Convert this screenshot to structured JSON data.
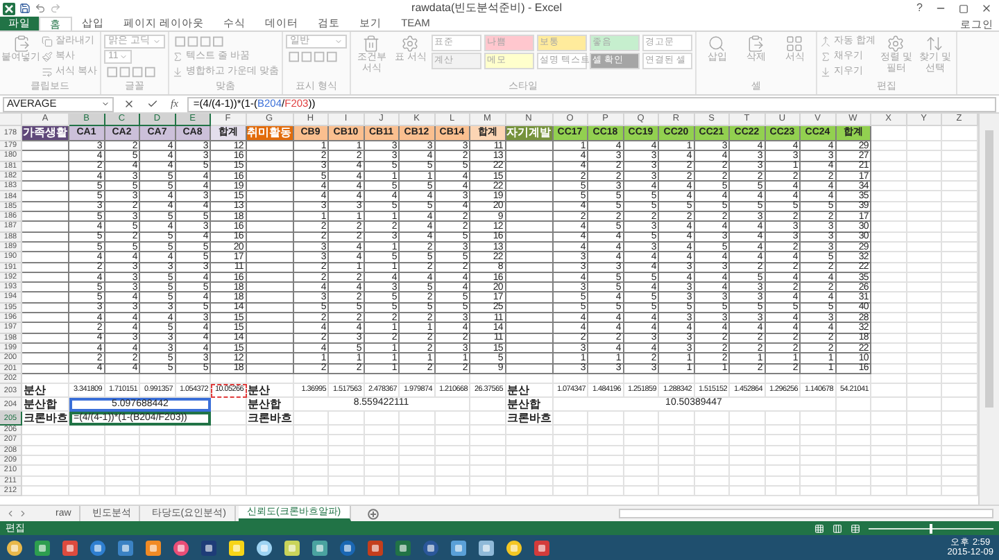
{
  "window": {
    "title": "rawdata(빈도분석준비) - Excel",
    "help": "?",
    "account": "로그인"
  },
  "ribbon_tabs": [
    {
      "label": "파일",
      "kind": "file",
      "selected": false
    },
    {
      "label": "홈",
      "kind": "tab",
      "selected": true
    },
    {
      "label": "삽입",
      "kind": "tab",
      "selected": false
    },
    {
      "label": "페이지 레이아웃",
      "kind": "tab",
      "selected": false
    },
    {
      "label": "수식",
      "kind": "tab",
      "selected": false
    },
    {
      "label": "데이터",
      "kind": "tab",
      "selected": false
    },
    {
      "label": "검토",
      "kind": "tab",
      "selected": false
    },
    {
      "label": "보기",
      "kind": "tab",
      "selected": false
    },
    {
      "label": "TEAM",
      "kind": "tab",
      "selected": false
    }
  ],
  "ribbon": {
    "disabled": true,
    "groups": [
      {
        "label": "클립보드",
        "items": [
          {
            "kind": "large",
            "text": "붙여넣기"
          },
          {
            "kind": "small",
            "text": "잘라내기"
          },
          {
            "kind": "small",
            "text": "복사"
          },
          {
            "kind": "small",
            "text": "서식 복사"
          }
        ]
      },
      {
        "label": "글꼴",
        "items": [
          {
            "kind": "field",
            "text": "맑은 고딕",
            "wide": true
          },
          {
            "kind": "field",
            "text": "11",
            "wide": false
          },
          {
            "kind": "tools"
          }
        ]
      },
      {
        "label": "맞춤",
        "items": [
          {
            "kind": "tools"
          },
          {
            "kind": "small",
            "text": "텍스트 줄 바꿈"
          },
          {
            "kind": "small",
            "text": "병합하고 가운데 맞춤"
          }
        ]
      },
      {
        "label": "표시 형식",
        "items": [
          {
            "kind": "field",
            "text": "일반",
            "wide": true
          },
          {
            "kind": "tools"
          }
        ]
      },
      {
        "label": "스타일",
        "items": [
          {
            "kind": "large",
            "text": "조건부 서식"
          },
          {
            "kind": "large",
            "text": "표 서식"
          },
          {
            "kind": "style",
            "text": "표준",
            "color": "#ffffff"
          },
          {
            "kind": "style",
            "text": "계산",
            "color": "#f2f2f2"
          },
          {
            "kind": "style",
            "text": "나쁨",
            "color": "#ffc7ce"
          },
          {
            "kind": "style",
            "text": "메모",
            "color": "#ffffcc"
          },
          {
            "kind": "style",
            "text": "보통",
            "color": "#ffeb9c"
          },
          {
            "kind": "style",
            "text": "설명 텍스트",
            "color": "#ffffff"
          },
          {
            "kind": "style",
            "text": "좋음",
            "color": "#c6efce"
          },
          {
            "kind": "style",
            "text": "셀 확인",
            "color": "#a5a5a5"
          },
          {
            "kind": "style",
            "text": "경고문",
            "color": "#ffffff"
          },
          {
            "kind": "style",
            "text": "연결된 셀",
            "color": "#ffffff"
          }
        ]
      },
      {
        "label": "셀",
        "items": [
          {
            "kind": "large",
            "text": "삽입"
          },
          {
            "kind": "large",
            "text": "삭제"
          },
          {
            "kind": "large",
            "text": "서식"
          }
        ]
      },
      {
        "label": "편집",
        "items": [
          {
            "kind": "small",
            "text": "자동 합계"
          },
          {
            "kind": "small",
            "text": "채우기"
          },
          {
            "kind": "small",
            "text": "지우기"
          },
          {
            "kind": "large",
            "text": "정렬 및 필터"
          },
          {
            "kind": "large",
            "text": "찾기 및 선택"
          }
        ]
      }
    ]
  },
  "formula_bar": {
    "name_box": "AVERAGE",
    "function_label": "fx",
    "formula": [
      {
        "text": "=(4/(4-1))*(1-("
      },
      {
        "text": "B204",
        "color": "#3a6fd8"
      },
      {
        "text": "/"
      },
      {
        "text": "F203",
        "color": "#e03c3c"
      },
      {
        "text": "))"
      }
    ]
  },
  "sheet": {
    "columns": [
      {
        "label": "A",
        "selected": false
      },
      {
        "label": "B",
        "selected": true
      },
      {
        "label": "C",
        "selected": true
      },
      {
        "label": "D",
        "selected": true
      },
      {
        "label": "E",
        "selected": true
      },
      {
        "label": "F",
        "selected": false
      },
      {
        "label": "G",
        "selected": false
      },
      {
        "label": "H",
        "selected": false
      },
      {
        "label": "I",
        "selected": false
      },
      {
        "label": "J",
        "selected": false
      },
      {
        "label": "K",
        "selected": false
      },
      {
        "label": "L",
        "selected": false
      },
      {
        "label": "M",
        "selected": false
      },
      {
        "label": "N",
        "selected": false
      },
      {
        "label": "O",
        "selected": false
      },
      {
        "label": "P",
        "selected": false
      },
      {
        "label": "Q",
        "selected": false
      },
      {
        "label": "R",
        "selected": false
      },
      {
        "label": "S",
        "selected": false
      },
      {
        "label": "T",
        "selected": false
      },
      {
        "label": "U",
        "selected": false
      },
      {
        "label": "V",
        "selected": false
      },
      {
        "label": "W",
        "selected": false
      },
      {
        "label": "X",
        "selected": false
      },
      {
        "label": "Y",
        "selected": false
      },
      {
        "label": "Z",
        "selected": false
      }
    ],
    "rows": [
      {
        "number": "178",
        "selected": false,
        "blocks": [
          {
            "label": {
              "text": "가족생활",
              "color": "#60497a"
            },
            "headings": [
              {
                "text": "CA1",
                "color": "#ccc0da"
              },
              {
                "text": "CA2",
                "color": "#ccc0da"
              },
              {
                "text": "CA7",
                "color": "#ccc0da"
              },
              {
                "text": "CA8",
                "color": "#ccc0da"
              },
              {
                "text": "합계",
                "color": "#e4dfec"
              }
            ]
          },
          {
            "label": {
              "text": "취미활동",
              "color": "#e26b0a"
            },
            "headings": [
              {
                "text": "CB9",
                "color": "#fabf8f"
              },
              {
                "text": "CB10",
                "color": "#fabf8f"
              },
              {
                "text": "CB11",
                "color": "#fabf8f"
              },
              {
                "text": "CB12",
                "color": "#fabf8f"
              },
              {
                "text": "CB14",
                "color": "#fabf8f"
              },
              {
                "text": "합계",
                "color": "#fcd5b4"
              }
            ]
          },
          {
            "label": {
              "text": "자기계발",
              "color": "#76933c"
            },
            "headings": [
              {
                "text": "CC17",
                "color": "#92d050"
              },
              {
                "text": "CC18",
                "color": "#92d050"
              },
              {
                "text": "CC19",
                "color": "#92d050"
              },
              {
                "text": "CC20",
                "color": "#92d050"
              },
              {
                "text": "CC21",
                "color": "#92d050"
              },
              {
                "text": "CC22",
                "color": "#92d050"
              },
              {
                "text": "CC23",
                "color": "#92d050"
              },
              {
                "text": "CC24",
                "color": "#92d050"
              },
              {
                "text": "합계",
                "color": "#92d050"
              }
            ]
          }
        ]
      },
      {
        "number": "179",
        "selected": false,
        "blocks": [
          {
            "values": [
              "3",
              "2",
              "4",
              "3",
              "12"
            ]
          },
          {
            "values": [
              "1",
              "1",
              "3",
              "3",
              "3",
              "11"
            ]
          },
          {
            "values": [
              "1",
              "4",
              "4",
              "1",
              "3",
              "4",
              "4",
              "4",
              "29"
            ]
          }
        ]
      },
      {
        "number": "180",
        "selected": false,
        "blocks": [
          {
            "values": [
              "4",
              "5",
              "4",
              "3",
              "16"
            ]
          },
          {
            "values": [
              "2",
              "2",
              "3",
              "4",
              "2",
              "13"
            ]
          },
          {
            "values": [
              "4",
              "3",
              "3",
              "4",
              "4",
              "3",
              "3",
              "3",
              "27"
            ]
          }
        ]
      },
      {
        "number": "181",
        "selected": false,
        "blocks": [
          {
            "values": [
              "2",
              "4",
              "4",
              "5",
              "15"
            ]
          },
          {
            "values": [
              "3",
              "4",
              "5",
              "5",
              "5",
              "22"
            ]
          },
          {
            "values": [
              "4",
              "2",
              "3",
              "2",
              "2",
              "3",
              "1",
              "4",
              "21"
            ]
          }
        ]
      },
      {
        "number": "182",
        "selected": false,
        "blocks": [
          {
            "values": [
              "4",
              "3",
              "5",
              "4",
              "16"
            ]
          },
          {
            "values": [
              "5",
              "4",
              "1",
              "1",
              "4",
              "15"
            ]
          },
          {
            "values": [
              "2",
              "2",
              "3",
              "2",
              "2",
              "2",
              "2",
              "2",
              "17"
            ]
          }
        ]
      },
      {
        "number": "183",
        "selected": false,
        "blocks": [
          {
            "values": [
              "5",
              "5",
              "5",
              "4",
              "19"
            ]
          },
          {
            "values": [
              "4",
              "4",
              "5",
              "5",
              "4",
              "22"
            ]
          },
          {
            "values": [
              "5",
              "3",
              "4",
              "4",
              "5",
              "5",
              "4",
              "4",
              "34"
            ]
          }
        ]
      },
      {
        "number": "184",
        "selected": false,
        "blocks": [
          {
            "values": [
              "5",
              "3",
              "4",
              "3",
              "15"
            ]
          },
          {
            "values": [
              "4",
              "4",
              "4",
              "4",
              "3",
              "19"
            ]
          },
          {
            "values": [
              "5",
              "5",
              "5",
              "4",
              "4",
              "4",
              "4",
              "4",
              "35"
            ]
          }
        ]
      },
      {
        "number": "185",
        "selected": false,
        "blocks": [
          {
            "values": [
              "3",
              "2",
              "4",
              "4",
              "13"
            ]
          },
          {
            "values": [
              "3",
              "3",
              "5",
              "5",
              "4",
              "20"
            ]
          },
          {
            "values": [
              "4",
              "5",
              "5",
              "5",
              "5",
              "5",
              "5",
              "5",
              "39"
            ]
          }
        ]
      },
      {
        "number": "186",
        "selected": false,
        "blocks": [
          {
            "values": [
              "5",
              "3",
              "5",
              "5",
              "18"
            ]
          },
          {
            "values": [
              "1",
              "1",
              "1",
              "4",
              "2",
              "9"
            ]
          },
          {
            "values": [
              "2",
              "2",
              "2",
              "2",
              "2",
              "3",
              "2",
              "2",
              "17"
            ]
          }
        ]
      },
      {
        "number": "187",
        "selected": false,
        "blocks": [
          {
            "values": [
              "4",
              "5",
              "4",
              "3",
              "16"
            ]
          },
          {
            "values": [
              "2",
              "2",
              "2",
              "4",
              "2",
              "12"
            ]
          },
          {
            "values": [
              "4",
              "5",
              "3",
              "4",
              "4",
              "4",
              "3",
              "3",
              "30"
            ]
          }
        ]
      },
      {
        "number": "188",
        "selected": false,
        "blocks": [
          {
            "values": [
              "5",
              "2",
              "5",
              "4",
              "16"
            ]
          },
          {
            "values": [
              "2",
              "2",
              "3",
              "4",
              "5",
              "16"
            ]
          },
          {
            "values": [
              "4",
              "4",
              "5",
              "4",
              "3",
              "4",
              "3",
              "3",
              "30"
            ]
          }
        ]
      },
      {
        "number": "189",
        "selected": false,
        "blocks": [
          {
            "values": [
              "5",
              "5",
              "5",
              "5",
              "20"
            ]
          },
          {
            "values": [
              "3",
              "4",
              "1",
              "2",
              "3",
              "13"
            ]
          },
          {
            "values": [
              "4",
              "4",
              "3",
              "4",
              "5",
              "4",
              "2",
              "3",
              "29"
            ]
          }
        ]
      },
      {
        "number": "190",
        "selected": false,
        "blocks": [
          {
            "values": [
              "4",
              "4",
              "4",
              "5",
              "17"
            ]
          },
          {
            "values": [
              "3",
              "4",
              "5",
              "5",
              "5",
              "22"
            ]
          },
          {
            "values": [
              "3",
              "4",
              "4",
              "4",
              "4",
              "4",
              "4",
              "5",
              "32"
            ]
          }
        ]
      },
      {
        "number": "191",
        "selected": false,
        "blocks": [
          {
            "values": [
              "2",
              "3",
              "3",
              "3",
              "11"
            ]
          },
          {
            "values": [
              "2",
              "1",
              "1",
              "2",
              "2",
              "8"
            ]
          },
          {
            "values": [
              "3",
              "3",
              "4",
              "3",
              "3",
              "2",
              "2",
              "2",
              "22"
            ]
          }
        ]
      },
      {
        "number": "192",
        "selected": false,
        "blocks": [
          {
            "values": [
              "4",
              "3",
              "5",
              "4",
              "16"
            ]
          },
          {
            "values": [
              "2",
              "2",
              "4",
              "4",
              "4",
              "16"
            ]
          },
          {
            "values": [
              "4",
              "5",
              "5",
              "4",
              "4",
              "5",
              "4",
              "4",
              "35"
            ]
          }
        ]
      },
      {
        "number": "193",
        "selected": false,
        "blocks": [
          {
            "values": [
              "5",
              "3",
              "5",
              "5",
              "18"
            ]
          },
          {
            "values": [
              "4",
              "4",
              "3",
              "5",
              "4",
              "20"
            ]
          },
          {
            "values": [
              "3",
              "5",
              "4",
              "3",
              "4",
              "3",
              "2",
              "2",
              "26"
            ]
          }
        ]
      },
      {
        "number": "194",
        "selected": false,
        "blocks": [
          {
            "values": [
              "5",
              "4",
              "5",
              "4",
              "18"
            ]
          },
          {
            "values": [
              "3",
              "2",
              "5",
              "2",
              "5",
              "17"
            ]
          },
          {
            "values": [
              "5",
              "4",
              "5",
              "3",
              "3",
              "3",
              "4",
              "4",
              "31"
            ]
          }
        ]
      },
      {
        "number": "195",
        "selected": false,
        "blocks": [
          {
            "values": [
              "3",
              "3",
              "3",
              "5",
              "14"
            ]
          },
          {
            "values": [
              "5",
              "5",
              "5",
              "5",
              "5",
              "25"
            ]
          },
          {
            "values": [
              "5",
              "5",
              "5",
              "5",
              "5",
              "5",
              "5",
              "5",
              "40"
            ]
          }
        ]
      },
      {
        "number": "196",
        "selected": false,
        "blocks": [
          {
            "values": [
              "4",
              "4",
              "4",
              "3",
              "15"
            ]
          },
          {
            "values": [
              "2",
              "2",
              "2",
              "2",
              "3",
              "11"
            ]
          },
          {
            "values": [
              "4",
              "4",
              "4",
              "3",
              "3",
              "3",
              "4",
              "3",
              "28"
            ]
          }
        ]
      },
      {
        "number": "197",
        "selected": false,
        "blocks": [
          {
            "values": [
              "2",
              "4",
              "5",
              "4",
              "15"
            ]
          },
          {
            "values": [
              "4",
              "4",
              "1",
              "1",
              "4",
              "14"
            ]
          },
          {
            "values": [
              "4",
              "4",
              "4",
              "4",
              "4",
              "4",
              "4",
              "4",
              "32"
            ]
          }
        ]
      },
      {
        "number": "198",
        "selected": false,
        "blocks": [
          {
            "values": [
              "4",
              "3",
              "3",
              "4",
              "14"
            ]
          },
          {
            "values": [
              "2",
              "3",
              "2",
              "2",
              "2",
              "11"
            ]
          },
          {
            "values": [
              "2",
              "2",
              "3",
              "3",
              "2",
              "2",
              "2",
              "2",
              "18"
            ]
          }
        ]
      },
      {
        "number": "199",
        "selected": false,
        "blocks": [
          {
            "values": [
              "4",
              "4",
              "3",
              "4",
              "15"
            ]
          },
          {
            "values": [
              "4",
              "5",
              "1",
              "2",
              "3",
              "15"
            ]
          },
          {
            "values": [
              "3",
              "4",
              "4",
              "3",
              "2",
              "2",
              "2",
              "2",
              "22"
            ]
          }
        ]
      },
      {
        "number": "200",
        "selected": false,
        "blocks": [
          {
            "values": [
              "2",
              "2",
              "5",
              "3",
              "12"
            ]
          },
          {
            "values": [
              "1",
              "1",
              "1",
              "1",
              "1",
              "5"
            ]
          },
          {
            "values": [
              "1",
              "1",
              "2",
              "1",
              "2",
              "1",
              "1",
              "1",
              "10"
            ]
          }
        ]
      },
      {
        "number": "201",
        "selected": false,
        "blocks": [
          {
            "values": [
              "4",
              "4",
              "5",
              "5",
              "18"
            ]
          },
          {
            "values": [
              "2",
              "2",
              "1",
              "2",
              "2",
              "9"
            ]
          },
          {
            "values": [
              "3",
              "3",
              "3",
              "1",
              "1",
              "2",
              "2",
              "1",
              "16"
            ]
          }
        ]
      },
      {
        "number": "202",
        "selected": false
      },
      {
        "number": "203",
        "selected": false,
        "blocks": [
          {
            "label": "분산",
            "values": [
              "3.341809",
              "1.710151",
              "0.991357",
              "1.054372",
              {
                "text": "10.05266",
                "color": "#e03c3c"
              }
            ]
          },
          {
            "label": "분산",
            "values": [
              "1.36995",
              "1.517563",
              "2.478367",
              "1.979874",
              "1.210668",
              "26.37565"
            ]
          },
          {
            "label": "분산",
            "values": [
              "1.074347",
              "1.484196",
              "1.251859",
              "1.288342",
              "1.515152",
              "1.452864",
              "1.296256",
              "1.140678",
              "54.21041"
            ]
          }
        ]
      },
      {
        "number": "204",
        "selected": false,
        "blocks": [
          {
            "label": "분산합",
            "merged": {
              "text": "5.097688442",
              "color": "#3a6fd8"
            }
          },
          {
            "label": "분산합",
            "merged": {
              "text": "8.559422111"
            }
          },
          {
            "label": "분산합",
            "merged": {
              "text": "10.50389447"
            }
          }
        ]
      },
      {
        "number": "205",
        "selected": true,
        "blocks": [
          {
            "label": "크론바흐",
            "formula": {
              "text": "=(4/(4-1))*(1-(B204/F203))",
              "color": "#217346"
            }
          },
          {
            "label": "크론바흐"
          },
          {
            "label": "크론바흐"
          }
        ]
      },
      {
        "number": "206",
        "selected": false
      },
      {
        "number": "207",
        "selected": false
      },
      {
        "number": "208",
        "selected": false
      },
      {
        "number": "209",
        "selected": false
      },
      {
        "number": "210",
        "selected": false
      },
      {
        "number": "211",
        "selected": false
      },
      {
        "number": "212",
        "selected": false
      }
    ]
  },
  "sheet_tabs": [
    {
      "label": "raw",
      "selected": false
    },
    {
      "label": "빈도분석",
      "selected": false
    },
    {
      "label": "타당도(요인분석)",
      "selected": false
    },
    {
      "label": "신뢰도(크론바흐알파)",
      "selected": true
    }
  ],
  "status_bar": {
    "mode": "편집",
    "zoom": {
      "level": 0.5
    }
  },
  "taskbar": {
    "time": "오후 2:59",
    "date": "2015-12-09"
  }
}
